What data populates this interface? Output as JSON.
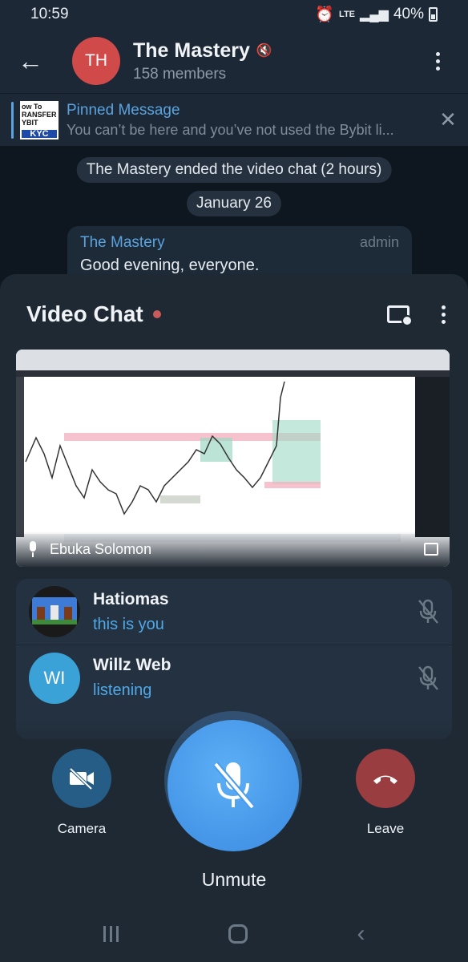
{
  "status_bar": {
    "time": "10:59",
    "network": "LTE",
    "battery": "40%"
  },
  "header": {
    "avatar_initials": "TH",
    "title": "The Mastery",
    "subtitle": "158 members"
  },
  "pinned": {
    "title": "Pinned Message",
    "text": "You can’t be here and you’ve not used the Bybit li...",
    "thumb_lines": [
      "ow To",
      "RANSFER",
      "YBIT"
    ],
    "thumb_badge": "KYC"
  },
  "chat": {
    "service_message": "The Mastery ended the video chat (2 hours)",
    "date_chip": "January 26",
    "message": {
      "author": "The Mastery",
      "role": "admin",
      "text": "Good evening, everyone."
    }
  },
  "video_chat": {
    "title": "Video Chat",
    "video_speaker": "Ebuka Solomon",
    "participants": [
      {
        "name": "Hatiomas",
        "status": "this is you"
      },
      {
        "name": "Willz Web",
        "avatar_initials": "WI",
        "status": "listening"
      }
    ],
    "controls": {
      "camera": "Camera",
      "leave": "Leave",
      "unmute": "Unmute"
    },
    "colors": {
      "camera_button": "#255d86",
      "leave_button": "#9a3d40",
      "unmute_button": "#4a9cec",
      "rec_dot": "#c95a5a"
    }
  }
}
